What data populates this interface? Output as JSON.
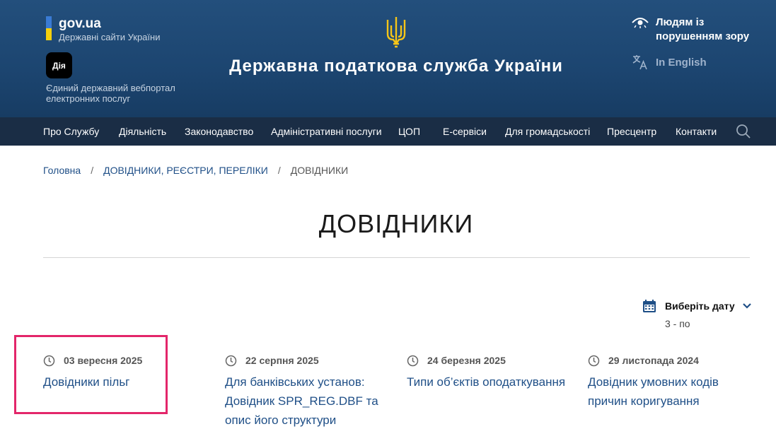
{
  "header": {
    "govua_name": "gov.ua",
    "govua_sub": "Державні сайти України",
    "diia_logo": "Дія",
    "diia_sub": "Єдиний державний вебпортал електронних послуг",
    "site_title": "Державна податкова служба України",
    "vision_label": "Людям із порушенням зору",
    "english_label": "In English"
  },
  "nav": {
    "items": [
      "Про Службу",
      "Діяльність",
      "Законодавство",
      "Адміністративні послуги",
      "ЦОП",
      "Е-сервіси",
      "Для громадськості",
      "Пресцентр",
      "Контакти"
    ]
  },
  "breadcrumb": {
    "home": "Головна",
    "section": "ДОВІДНИКИ, РЕЄСТРИ, ПЕРЕЛІКИ",
    "current": "ДОВІДНИКИ"
  },
  "page_title": "ДОВІДНИКИ",
  "date_filter": {
    "label": "Виберіть дату",
    "sub": "3 - по"
  },
  "cards": [
    {
      "date": "03 вересня 2025",
      "title": "Довідники пільг"
    },
    {
      "date": "22 серпня 2025",
      "title": "Для банківських установ: Довідник SPR_REG.DBF та опис його структури"
    },
    {
      "date": "24 березня 2025",
      "title": "Типи об’єктів оподаткування"
    },
    {
      "date": "29 листопада 2024",
      "title": "Довідник умовних кодів причин коригування"
    }
  ],
  "colors": {
    "header_bg": "#1c4570",
    "nav_bg": "#1a2d45",
    "link": "#1f4f87",
    "highlight": "#e3266a",
    "trident": "#f5c518"
  },
  "icons": [
    "trident-icon",
    "eye-icon",
    "translate-icon",
    "search-icon",
    "calendar-icon",
    "chevron-down-icon",
    "clock-icon"
  ]
}
